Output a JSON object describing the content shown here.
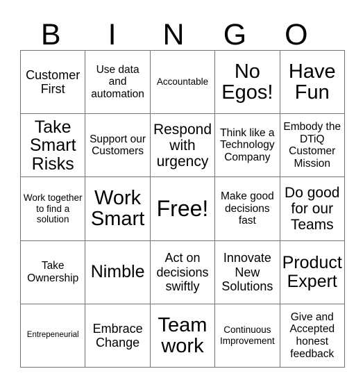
{
  "card": {
    "header_letters": [
      "B",
      "I",
      "N",
      "G",
      "O"
    ],
    "free_space_label": "Free!",
    "grid_size": "5x5",
    "colors": {
      "text": "#000000",
      "grid_line": "#737373",
      "background": "#ffffff"
    },
    "rows": [
      [
        {
          "text": "Customer First",
          "size": "lg"
        },
        {
          "text": "Use data and automation",
          "size": "md"
        },
        {
          "text": "Accountable",
          "size": "sm"
        },
        {
          "text": "No Egos!",
          "size": "3xl"
        },
        {
          "text": "Have Fun",
          "size": "3xl"
        }
      ],
      [
        {
          "text": "Take Smart Risks",
          "size": "2xl"
        },
        {
          "text": "Support our Customers",
          "size": "md"
        },
        {
          "text": "Respond with urgency",
          "size": "xl"
        },
        {
          "text": "Think like a Technology Company",
          "size": "md"
        },
        {
          "text": "Embody the DTiQ Customer Mission",
          "size": "md"
        }
      ],
      [
        {
          "text": "Work together to find a solution",
          "size": "sm"
        },
        {
          "text": "Work Smart",
          "size": "3xl"
        },
        {
          "text": "Free!",
          "size": "4xl"
        },
        {
          "text": "Make good decisions fast",
          "size": "md"
        },
        {
          "text": "Do good for our Teams",
          "size": "xl"
        }
      ],
      [
        {
          "text": "Take Ownership",
          "size": "md"
        },
        {
          "text": "Nimble",
          "size": "2xl"
        },
        {
          "text": "Act on decisions swiftly",
          "size": "lg"
        },
        {
          "text": "Innovate New Solutions",
          "size": "lg"
        },
        {
          "text": "Product Expert",
          "size": "2xl"
        }
      ],
      [
        {
          "text": "Entrepeneurial",
          "size": "xs"
        },
        {
          "text": "Embrace Change",
          "size": "lg"
        },
        {
          "text": "Team work",
          "size": "3xl"
        },
        {
          "text": "Continuous Improvement",
          "size": "sm"
        },
        {
          "text": "Give and Accepted honest feedback",
          "size": "md"
        }
      ]
    ]
  }
}
